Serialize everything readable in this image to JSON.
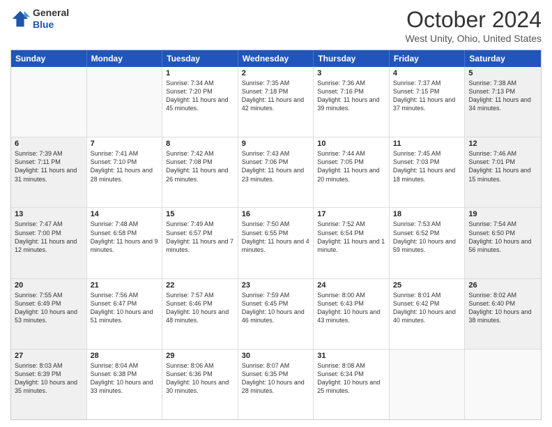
{
  "header": {
    "logo_line1": "General",
    "logo_line2": "Blue",
    "month": "October 2024",
    "location": "West Unity, Ohio, United States"
  },
  "weekdays": [
    "Sunday",
    "Monday",
    "Tuesday",
    "Wednesday",
    "Thursday",
    "Friday",
    "Saturday"
  ],
  "rows": [
    [
      {
        "day": "",
        "text": "",
        "shaded": false,
        "empty": true
      },
      {
        "day": "",
        "text": "",
        "shaded": false,
        "empty": true
      },
      {
        "day": "1",
        "text": "Sunrise: 7:34 AM\nSunset: 7:20 PM\nDaylight: 11 hours and 45 minutes.",
        "shaded": false
      },
      {
        "day": "2",
        "text": "Sunrise: 7:35 AM\nSunset: 7:18 PM\nDaylight: 11 hours and 42 minutes.",
        "shaded": false
      },
      {
        "day": "3",
        "text": "Sunrise: 7:36 AM\nSunset: 7:16 PM\nDaylight: 11 hours and 39 minutes.",
        "shaded": false
      },
      {
        "day": "4",
        "text": "Sunrise: 7:37 AM\nSunset: 7:15 PM\nDaylight: 11 hours and 37 minutes.",
        "shaded": false
      },
      {
        "day": "5",
        "text": "Sunrise: 7:38 AM\nSunset: 7:13 PM\nDaylight: 11 hours and 34 minutes.",
        "shaded": true
      }
    ],
    [
      {
        "day": "6",
        "text": "Sunrise: 7:39 AM\nSunset: 7:11 PM\nDaylight: 11 hours and 31 minutes.",
        "shaded": true
      },
      {
        "day": "7",
        "text": "Sunrise: 7:41 AM\nSunset: 7:10 PM\nDaylight: 11 hours and 28 minutes.",
        "shaded": false
      },
      {
        "day": "8",
        "text": "Sunrise: 7:42 AM\nSunset: 7:08 PM\nDaylight: 11 hours and 26 minutes.",
        "shaded": false
      },
      {
        "day": "9",
        "text": "Sunrise: 7:43 AM\nSunset: 7:06 PM\nDaylight: 11 hours and 23 minutes.",
        "shaded": false
      },
      {
        "day": "10",
        "text": "Sunrise: 7:44 AM\nSunset: 7:05 PM\nDaylight: 11 hours and 20 minutes.",
        "shaded": false
      },
      {
        "day": "11",
        "text": "Sunrise: 7:45 AM\nSunset: 7:03 PM\nDaylight: 11 hours and 18 minutes.",
        "shaded": false
      },
      {
        "day": "12",
        "text": "Sunrise: 7:46 AM\nSunset: 7:01 PM\nDaylight: 11 hours and 15 minutes.",
        "shaded": true
      }
    ],
    [
      {
        "day": "13",
        "text": "Sunrise: 7:47 AM\nSunset: 7:00 PM\nDaylight: 11 hours and 12 minutes.",
        "shaded": true
      },
      {
        "day": "14",
        "text": "Sunrise: 7:48 AM\nSunset: 6:58 PM\nDaylight: 11 hours and 9 minutes.",
        "shaded": false
      },
      {
        "day": "15",
        "text": "Sunrise: 7:49 AM\nSunset: 6:57 PM\nDaylight: 11 hours and 7 minutes.",
        "shaded": false
      },
      {
        "day": "16",
        "text": "Sunrise: 7:50 AM\nSunset: 6:55 PM\nDaylight: 11 hours and 4 minutes.",
        "shaded": false
      },
      {
        "day": "17",
        "text": "Sunrise: 7:52 AM\nSunset: 6:54 PM\nDaylight: 11 hours and 1 minute.",
        "shaded": false
      },
      {
        "day": "18",
        "text": "Sunrise: 7:53 AM\nSunset: 6:52 PM\nDaylight: 10 hours and 59 minutes.",
        "shaded": false
      },
      {
        "day": "19",
        "text": "Sunrise: 7:54 AM\nSunset: 6:50 PM\nDaylight: 10 hours and 56 minutes.",
        "shaded": true
      }
    ],
    [
      {
        "day": "20",
        "text": "Sunrise: 7:55 AM\nSunset: 6:49 PM\nDaylight: 10 hours and 53 minutes.",
        "shaded": true
      },
      {
        "day": "21",
        "text": "Sunrise: 7:56 AM\nSunset: 6:47 PM\nDaylight: 10 hours and 51 minutes.",
        "shaded": false
      },
      {
        "day": "22",
        "text": "Sunrise: 7:57 AM\nSunset: 6:46 PM\nDaylight: 10 hours and 48 minutes.",
        "shaded": false
      },
      {
        "day": "23",
        "text": "Sunrise: 7:59 AM\nSunset: 6:45 PM\nDaylight: 10 hours and 46 minutes.",
        "shaded": false
      },
      {
        "day": "24",
        "text": "Sunrise: 8:00 AM\nSunset: 6:43 PM\nDaylight: 10 hours and 43 minutes.",
        "shaded": false
      },
      {
        "day": "25",
        "text": "Sunrise: 8:01 AM\nSunset: 6:42 PM\nDaylight: 10 hours and 40 minutes.",
        "shaded": false
      },
      {
        "day": "26",
        "text": "Sunrise: 8:02 AM\nSunset: 6:40 PM\nDaylight: 10 hours and 38 minutes.",
        "shaded": true
      }
    ],
    [
      {
        "day": "27",
        "text": "Sunrise: 8:03 AM\nSunset: 6:39 PM\nDaylight: 10 hours and 35 minutes.",
        "shaded": true
      },
      {
        "day": "28",
        "text": "Sunrise: 8:04 AM\nSunset: 6:38 PM\nDaylight: 10 hours and 33 minutes.",
        "shaded": false
      },
      {
        "day": "29",
        "text": "Sunrise: 8:06 AM\nSunset: 6:36 PM\nDaylight: 10 hours and 30 minutes.",
        "shaded": false
      },
      {
        "day": "30",
        "text": "Sunrise: 8:07 AM\nSunset: 6:35 PM\nDaylight: 10 hours and 28 minutes.",
        "shaded": false
      },
      {
        "day": "31",
        "text": "Sunrise: 8:08 AM\nSunset: 6:34 PM\nDaylight: 10 hours and 25 minutes.",
        "shaded": false
      },
      {
        "day": "",
        "text": "",
        "shaded": false,
        "empty": true
      },
      {
        "day": "",
        "text": "",
        "shaded": false,
        "empty": true
      }
    ]
  ]
}
